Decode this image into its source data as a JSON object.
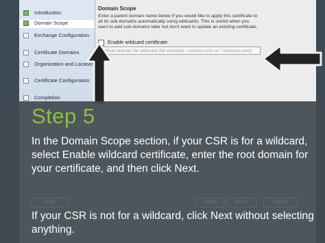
{
  "sidebar": {
    "items": [
      {
        "label": "Introduction",
        "done": true
      },
      {
        "label": "Domain Scope",
        "done": true,
        "active": true
      },
      {
        "label": "Exchange Configuration",
        "done": false
      },
      {
        "label": "Certificate Domains",
        "done": false
      },
      {
        "label": "Organization and Location",
        "done": false
      },
      {
        "label": "Certificate Configuration",
        "done": false
      },
      {
        "label": "Completion",
        "done": false
      }
    ]
  },
  "main": {
    "section_title": "Domain Scope",
    "description": "Enter a parent domain name below if you would like to apply this certificate to all its sub-domains automatically using wildcards. This is useful when you want to add sub-domains later but don't want to update an existing certificate.",
    "checkbox_label": "Enable wildcard certificate",
    "root_placeholder": "Root domain for wildcard (for example, contoso.com or *.contoso.com):"
  },
  "buttons": {
    "help": "Help",
    "back": "< Back",
    "next": "Next >",
    "cancel": "Cancel"
  },
  "overlay": {
    "step_title": "Step 5",
    "instruction_1": "In the Domain Scope section, if your CSR is for a wildcard, select Enable wildcard certificate, enter the root domain for your certificate, and then click Next.",
    "instruction_2": "If your CSR is not for a wildcard, click Next without selecting anything."
  },
  "colors": {
    "step_accent": "#8fbf3f",
    "overlay_bg": "#424a52"
  }
}
